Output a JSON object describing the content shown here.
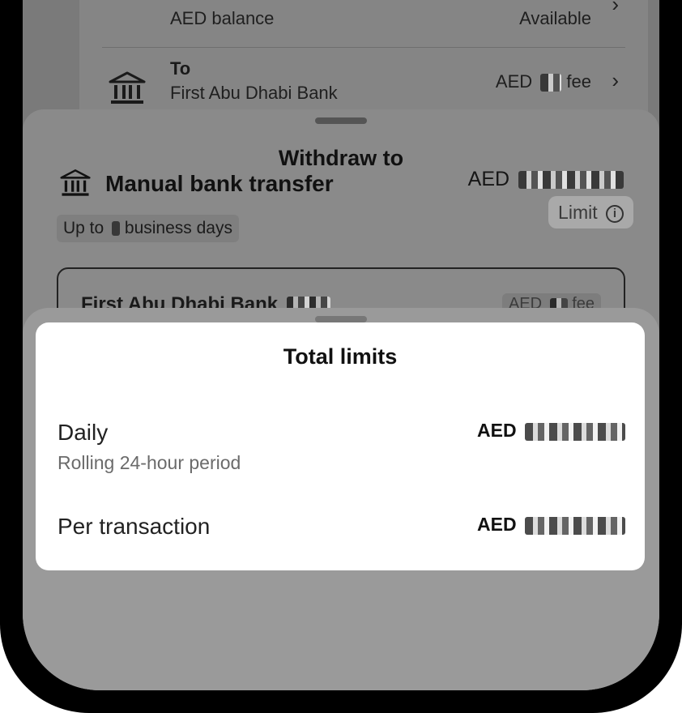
{
  "source_card": {
    "balance_label": "AED balance",
    "balance_status": "Available"
  },
  "to_row": {
    "title": "To",
    "bank_name": "First Abu Dhabi Bank",
    "fee_prefix": "AED",
    "fee_suffix": "fee"
  },
  "withdraw_sheet": {
    "title": "Withdraw to",
    "method_title": "Manual bank transfer",
    "amount_prefix": "AED",
    "days_prefix": "Up to",
    "days_suffix": "business days",
    "limit_button": "Limit",
    "bank_option_name": "First Abu Dhabi Bank",
    "bank_option_fee": "AED",
    "bank_option_fee_suffix": "fee"
  },
  "limits_dialog": {
    "title": "Total limits",
    "daily_label": "Daily",
    "daily_sub": "Rolling 24-hour period",
    "daily_value_prefix": "AED",
    "per_tx_label": "Per transaction",
    "per_tx_value_prefix": "AED"
  },
  "icons": [
    "bank-icon",
    "chevron-right-icon",
    "info-icon",
    "currency-coin-icon"
  ],
  "colors": {
    "coin_bg": "#0f3b22",
    "dialog_bg": "#ffffff",
    "overlay": "#7a7a7a"
  }
}
